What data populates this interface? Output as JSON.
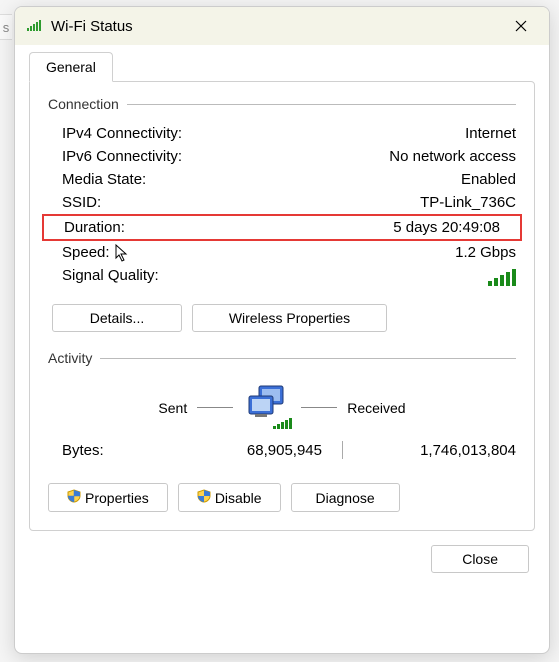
{
  "title": "Wi-Fi Status",
  "tab": "General",
  "connection": {
    "header": "Connection",
    "ipv4": {
      "label": "IPv4 Connectivity:",
      "value": "Internet"
    },
    "ipv6": {
      "label": "IPv6 Connectivity:",
      "value": "No network access"
    },
    "media": {
      "label": "Media State:",
      "value": "Enabled"
    },
    "ssid": {
      "label": "SSID:",
      "value": "TP-Link_736C"
    },
    "duration": {
      "label": "Duration:",
      "value": "5 days 20:49:08"
    },
    "speed": {
      "label": "Speed:",
      "value": "1.2 Gbps"
    },
    "signal": {
      "label": "Signal Quality:"
    },
    "details_btn": "Details...",
    "wireless_btn": "Wireless Properties"
  },
  "activity": {
    "header": "Activity",
    "sent": "Sent",
    "received": "Received",
    "bytes_label": "Bytes:",
    "bytes_sent": "68,905,945",
    "bytes_received": "1,746,013,804"
  },
  "buttons": {
    "properties": "Properties",
    "disable": "Disable",
    "diagnose": "Diagnose",
    "close": "Close"
  }
}
